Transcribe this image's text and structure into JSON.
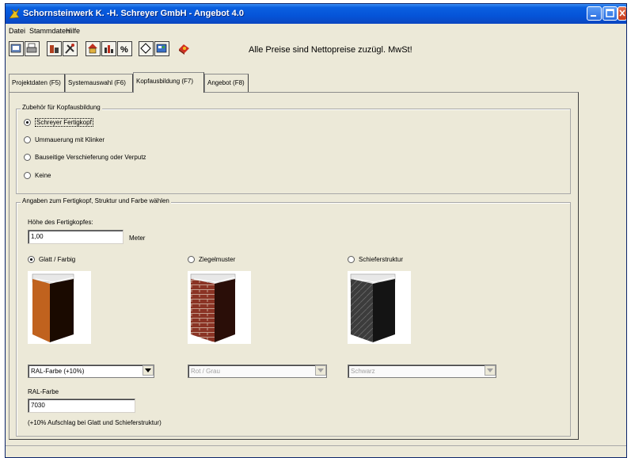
{
  "window": {
    "title": "Schornsteinwerk K. -H. Schreyer GmbH - Angebot 4.0"
  },
  "menu": [
    "Datei",
    "Stammdaten",
    "Hilfe"
  ],
  "toolbar": {
    "note": "Alle Preise sind Nettopreise zuzügl. MwSt!",
    "buttons": [
      "new-icon",
      "print-icon",
      "chimney-icon",
      "tools-icon",
      "house-icon",
      "chart-icon",
      "percent-icon",
      "diamond-icon",
      "grid-icon",
      "book-icon"
    ]
  },
  "tabs": [
    {
      "label": "Projektdaten (F5)",
      "active": false
    },
    {
      "label": "Systemauswahl (F6)",
      "active": false
    },
    {
      "label": "Kopfausbildung (F7)",
      "active": true
    },
    {
      "label": "Angebot (F8)",
      "active": false
    }
  ],
  "zubehoer": {
    "legend": "Zubehör für Kopfausbildung",
    "options": [
      {
        "label": "Schreyer Fertigkopf",
        "selected": true
      },
      {
        "label": "Ummauerung mit Klinker",
        "selected": false
      },
      {
        "label": "Bauseitige Verschieferung oder Verputz",
        "selected": false
      },
      {
        "label": "Keine",
        "selected": false
      }
    ]
  },
  "angaben": {
    "legend": "Angaben zum Fertigkopf, Struktur und Farbe wählen",
    "height_label": "Höhe des Fertigkopfes:",
    "height_value": "1,00",
    "height_unit": "Meter",
    "structures": [
      {
        "label": "Glatt / Farbig",
        "selected": true,
        "select_value": "RAL-Farbe (+10%)",
        "enabled": true,
        "color": "#b0521e"
      },
      {
        "label": "Ziegelmuster",
        "selected": false,
        "select_value": "Rot / Grau",
        "enabled": false,
        "color": "#8a3a2a"
      },
      {
        "label": "Schieferstruktur",
        "selected": false,
        "select_value": "Schwarz",
        "enabled": false,
        "color": "#3a3a3a"
      }
    ],
    "ral_label": "RAL-Farbe",
    "ral_value": "7030",
    "note": "(+10% Aufschlag bei Glatt und Schieferstruktur)"
  },
  "colors": {
    "titlebar": "#0554d8",
    "face": "#ece9d8"
  }
}
